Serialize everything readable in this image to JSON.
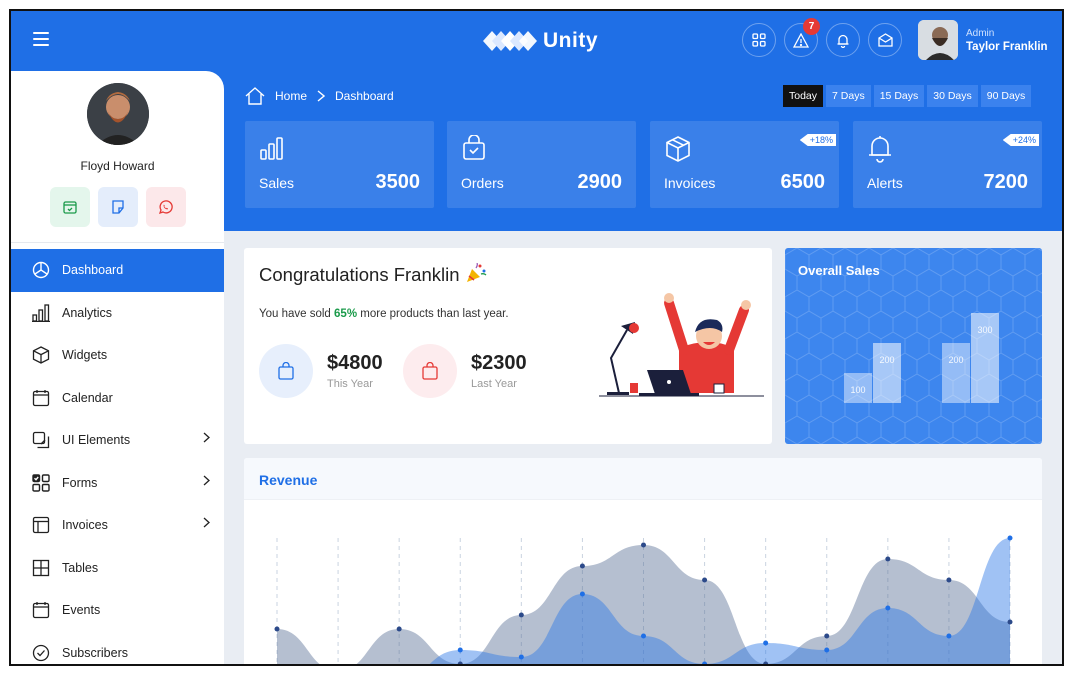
{
  "app": {
    "name": "Unity"
  },
  "user": {
    "role": "Admin",
    "name": "Taylor Franklin"
  },
  "notifications": {
    "alert_count": "7"
  },
  "colors": {
    "primary": "#1f6fe6",
    "success": "#1a9a4a",
    "danger": "#e53935"
  },
  "profile": {
    "name": "Floyd Howard",
    "actions": [
      "calendar-icon",
      "sticky-note-icon",
      "whatsapp-icon"
    ]
  },
  "sidebar": {
    "items": [
      {
        "label": "Dashboard",
        "icon": "pie-chart-icon"
      },
      {
        "label": "Analytics",
        "icon": "bar-chart-icon"
      },
      {
        "label": "Widgets",
        "icon": "box-icon"
      },
      {
        "label": "Calendar",
        "icon": "calendar-icon"
      },
      {
        "label": "UI Elements",
        "icon": "layers-icon"
      },
      {
        "label": "Forms",
        "icon": "check-grid-icon"
      },
      {
        "label": "Invoices",
        "icon": "browser-icon"
      },
      {
        "label": "Tables",
        "icon": "table-icon"
      },
      {
        "label": "Events",
        "icon": "events-icon"
      },
      {
        "label": "Subscribers",
        "icon": "check-circle-icon"
      }
    ]
  },
  "breadcrumb": {
    "home": "Home",
    "current": "Dashboard"
  },
  "ranges": [
    "Today",
    "7 Days",
    "15 Days",
    "30 Days",
    "90 Days"
  ],
  "stats": [
    {
      "label": "Sales",
      "value": "3500",
      "tag": ""
    },
    {
      "label": "Orders",
      "value": "2900",
      "tag": ""
    },
    {
      "label": "Invoices",
      "value": "6500",
      "tag": "+18%"
    },
    {
      "label": "Alerts",
      "value": "7200",
      "tag": "+24%"
    }
  ],
  "congrats": {
    "title": "Congratulations Franklin",
    "sub_before": "You have sold ",
    "sub_pct": "65%",
    "sub_after": " more products than last year.",
    "this_year_value": "$4800",
    "this_year_label": "This Year",
    "last_year_value": "$2300",
    "last_year_label": "Last Year"
  },
  "overall_sales": {
    "title": "Overall Sales",
    "chart_data": {
      "type": "bar",
      "series": [
        {
          "values": [
            100,
            200
          ]
        },
        {
          "values": [
            200,
            300
          ]
        }
      ]
    }
  },
  "revenue": {
    "title": "Revenue",
    "chart_data": {
      "type": "area",
      "series": [
        {
          "values": [
            0.35,
            0.05,
            0.35,
            0.1,
            0.45,
            0.8,
            0.95,
            0.7,
            0.1,
            0.3,
            0.85,
            0.7,
            0.4
          ]
        },
        {
          "values": [
            0.0,
            0.0,
            0.0,
            0.2,
            0.15,
            0.6,
            0.3,
            0.1,
            0.25,
            0.2,
            0.5,
            0.3,
            1.0
          ]
        }
      ]
    }
  }
}
